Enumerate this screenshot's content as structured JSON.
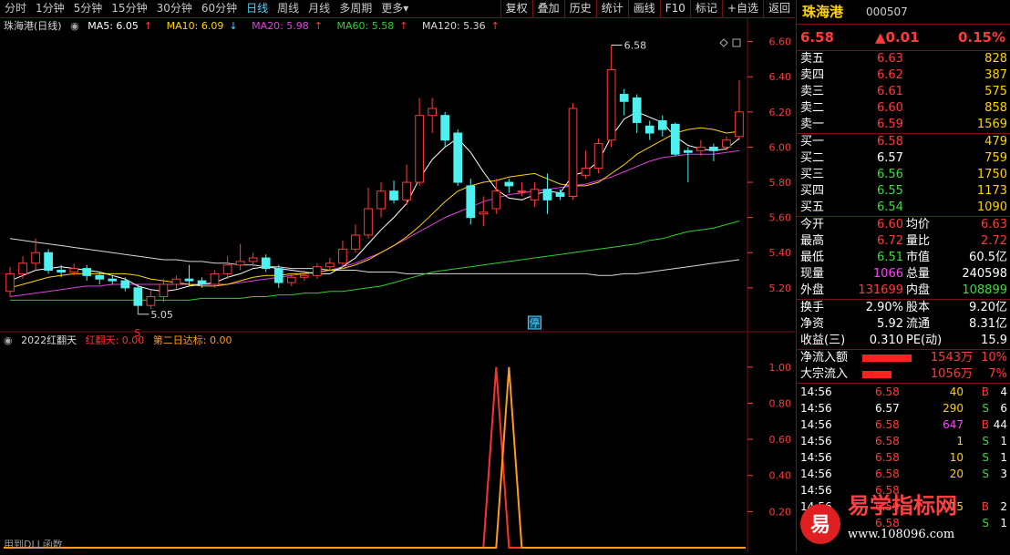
{
  "tabs": [
    "分时",
    "1分钟",
    "5分钟",
    "15分钟",
    "30分钟",
    "60分钟",
    "日线",
    "周线",
    "月线",
    "多周期",
    "更多"
  ],
  "active_tab": "日线",
  "more_arrow": "▾",
  "toolbar": [
    "复权",
    "叠加",
    "历史",
    "统计",
    "画线",
    "F10",
    "标记",
    "+自选",
    "返回"
  ],
  "legend": {
    "title": "珠海港(日线)",
    "ma5": "MA5: 6.05",
    "ma5_arrow": "↑",
    "ma10": "MA10: 6.09",
    "ma10_arrow": "↓",
    "ma20": "MA20: 5.98",
    "ma20_arrow": "↑",
    "ma60": "MA60: 5.58",
    "ma60_arrow": "↑",
    "ma120": "MA120: 5.36",
    "ma120_arrow": "↑"
  },
  "indicator_legend": {
    "name": "2022红翻天",
    "s1": "红翻天: 0.00",
    "s2": "第二日达标: 0.00"
  },
  "bottom_note": "用到DLL函数",
  "markers": {
    "low_label": "5.05",
    "high_label": "6.58",
    "stop_badge": "停",
    "signal": "S"
  },
  "colors": {
    "up": "#ff3a3a",
    "down": "#4ff0f0",
    "ma5": "#ffffff",
    "ma10": "#ffd200",
    "ma20": "#e040e0",
    "ma60": "#30d030",
    "ma120": "#d8d8d8",
    "ind1": "#ff3030",
    "ind2": "#ff9a20",
    "grid": "#7a1010"
  },
  "chart_data": [
    {
      "type": "candlestick",
      "title": "珠海港(日线)",
      "ylim": [
        5.08,
        6.65
      ],
      "yticks": [
        "6.60",
        "6.40",
        "6.20",
        "6.00",
        "5.80",
        "5.60",
        "5.40",
        "5.20"
      ],
      "candles": [
        [
          5.18,
          5.28,
          5.32,
          5.15
        ],
        [
          5.28,
          5.34,
          5.38,
          5.25
        ],
        [
          5.34,
          5.4,
          5.48,
          5.3
        ],
        [
          5.4,
          5.3,
          5.42,
          5.28
        ],
        [
          5.3,
          5.29,
          5.33,
          5.26
        ],
        [
          5.29,
          5.31,
          5.34,
          5.27
        ],
        [
          5.31,
          5.27,
          5.33,
          5.24
        ],
        [
          5.27,
          5.25,
          5.29,
          5.22
        ],
        [
          5.25,
          5.24,
          5.27,
          5.22
        ],
        [
          5.24,
          5.2,
          5.26,
          5.18
        ],
        [
          5.2,
          5.1,
          5.22,
          5.05
        ],
        [
          5.1,
          5.15,
          5.19,
          5.08
        ],
        [
          5.15,
          5.22,
          5.25,
          5.12
        ],
        [
          5.22,
          5.25,
          5.27,
          5.19
        ],
        [
          5.25,
          5.24,
          5.33,
          5.21
        ],
        [
          5.24,
          5.22,
          5.26,
          5.2
        ],
        [
          5.22,
          5.28,
          5.3,
          5.2
        ],
        [
          5.28,
          5.33,
          5.38,
          5.25
        ],
        [
          5.33,
          5.35,
          5.45,
          5.3
        ],
        [
          5.35,
          5.37,
          5.4,
          5.32
        ],
        [
          5.37,
          5.31,
          5.39,
          5.29
        ],
        [
          5.31,
          5.23,
          5.33,
          5.2
        ],
        [
          5.23,
          5.26,
          5.28,
          5.21
        ],
        [
          5.26,
          5.27,
          5.3,
          5.24
        ],
        [
          5.27,
          5.32,
          5.34,
          5.25
        ],
        [
          5.32,
          5.34,
          5.37,
          5.3
        ],
        [
          5.34,
          5.42,
          5.47,
          5.32
        ],
        [
          5.42,
          5.5,
          5.56,
          5.4
        ],
        [
          5.5,
          5.65,
          5.77,
          5.48
        ],
        [
          5.65,
          5.75,
          5.8,
          5.6
        ],
        [
          5.75,
          5.7,
          5.81,
          5.68
        ],
        [
          5.7,
          5.8,
          5.9,
          5.67
        ],
        [
          5.8,
          6.18,
          6.28,
          5.78
        ],
        [
          6.18,
          6.22,
          6.28,
          6.08
        ],
        [
          6.18,
          6.04,
          6.2,
          6.0
        ],
        [
          6.08,
          5.8,
          6.1,
          5.78
        ],
        [
          5.78,
          5.6,
          5.82,
          5.56
        ],
        [
          5.62,
          5.63,
          5.72,
          5.55
        ],
        [
          5.65,
          5.75,
          5.82,
          5.62
        ],
        [
          5.8,
          5.78,
          5.82,
          5.74
        ],
        [
          5.75,
          5.75,
          5.8,
          5.72
        ],
        [
          5.7,
          5.76,
          5.8,
          5.66
        ],
        [
          5.76,
          5.7,
          5.85,
          5.62
        ],
        [
          5.74,
          5.72,
          5.76,
          5.7
        ],
        [
          5.72,
          6.22,
          6.25,
          5.7
        ],
        [
          5.84,
          5.88,
          5.98,
          5.82
        ],
        [
          5.88,
          6.02,
          6.05,
          5.85
        ],
        [
          6.04,
          6.44,
          6.58,
          6.0
        ],
        [
          6.3,
          6.26,
          6.33,
          6.18
        ],
        [
          6.28,
          6.14,
          6.3,
          6.08
        ],
        [
          6.12,
          6.08,
          6.15,
          6.04
        ],
        [
          6.15,
          6.1,
          6.18,
          6.06
        ],
        [
          6.13,
          5.96,
          6.14,
          5.95
        ],
        [
          5.98,
          5.97,
          6.0,
          5.8
        ],
        [
          5.98,
          6.0,
          6.04,
          5.95
        ],
        [
          6.0,
          5.98,
          6.02,
          5.92
        ],
        [
          6.0,
          6.04,
          6.06,
          5.98
        ],
        [
          6.06,
          6.2,
          6.38,
          6.04
        ]
      ],
      "ma5": [
        5.24,
        5.27,
        5.3,
        5.31,
        5.32,
        5.31,
        5.3,
        5.29,
        5.27,
        5.25,
        5.21,
        5.19,
        5.18,
        5.19,
        5.21,
        5.22,
        5.23,
        5.26,
        5.28,
        5.31,
        5.32,
        5.31,
        5.3,
        5.29,
        5.28,
        5.28,
        5.32,
        5.37,
        5.45,
        5.53,
        5.6,
        5.68,
        5.82,
        5.93,
        6.0,
        6.05,
        5.97,
        5.86,
        5.76,
        5.71,
        5.7,
        5.73,
        5.75,
        5.74,
        5.84,
        5.86,
        5.92,
        6.06,
        6.16,
        6.2,
        6.17,
        6.14,
        6.06,
        6.01,
        5.99,
        5.98,
        5.99,
        6.05
      ],
      "ma10": [
        5.2,
        5.22,
        5.24,
        5.26,
        5.27,
        5.28,
        5.28,
        5.28,
        5.28,
        5.28,
        5.27,
        5.25,
        5.24,
        5.23,
        5.22,
        5.21,
        5.21,
        5.22,
        5.24,
        5.26,
        5.27,
        5.27,
        5.28,
        5.28,
        5.29,
        5.3,
        5.31,
        5.33,
        5.36,
        5.4,
        5.44,
        5.49,
        5.55,
        5.62,
        5.69,
        5.75,
        5.78,
        5.8,
        5.81,
        5.83,
        5.84,
        5.85,
        5.82,
        5.79,
        5.78,
        5.78,
        5.8,
        5.85,
        5.9,
        5.96,
        6.0,
        6.04,
        6.08,
        6.1,
        6.11,
        6.1,
        6.08,
        6.09
      ],
      "ma20": [
        5.15,
        5.16,
        5.17,
        5.18,
        5.19,
        5.2,
        5.21,
        5.21,
        5.22,
        5.22,
        5.22,
        5.22,
        5.22,
        5.22,
        5.22,
        5.22,
        5.22,
        5.22,
        5.23,
        5.24,
        5.25,
        5.26,
        5.27,
        5.28,
        5.29,
        5.3,
        5.32,
        5.34,
        5.37,
        5.4,
        5.44,
        5.48,
        5.52,
        5.56,
        5.6,
        5.63,
        5.66,
        5.69,
        5.71,
        5.73,
        5.74,
        5.75,
        5.76,
        5.77,
        5.78,
        5.79,
        5.81,
        5.83,
        5.86,
        5.89,
        5.92,
        5.94,
        5.95,
        5.96,
        5.96,
        5.96,
        5.97,
        5.98
      ],
      "ma60": [
        5.13,
        5.13,
        5.13,
        5.13,
        5.13,
        5.13,
        5.13,
        5.13,
        5.13,
        5.13,
        5.13,
        5.13,
        5.13,
        5.13,
        5.13,
        5.14,
        5.14,
        5.14,
        5.14,
        5.15,
        5.15,
        5.16,
        5.16,
        5.17,
        5.17,
        5.18,
        5.18,
        5.19,
        5.2,
        5.21,
        5.23,
        5.25,
        5.27,
        5.29,
        5.3,
        5.31,
        5.32,
        5.33,
        5.34,
        5.35,
        5.36,
        5.37,
        5.38,
        5.39,
        5.4,
        5.41,
        5.42,
        5.43,
        5.44,
        5.45,
        5.47,
        5.48,
        5.5,
        5.52,
        5.53,
        5.54,
        5.56,
        5.58
      ],
      "ma120": [
        5.48,
        5.47,
        5.46,
        5.45,
        5.44,
        5.43,
        5.42,
        5.41,
        5.4,
        5.39,
        5.38,
        5.37,
        5.36,
        5.36,
        5.35,
        5.35,
        5.34,
        5.34,
        5.33,
        5.33,
        5.32,
        5.32,
        5.31,
        5.31,
        5.31,
        5.3,
        5.3,
        5.3,
        5.29,
        5.29,
        5.29,
        5.28,
        5.28,
        5.28,
        5.28,
        5.28,
        5.28,
        5.28,
        5.28,
        5.28,
        5.28,
        5.28,
        5.28,
        5.28,
        5.28,
        5.28,
        5.27,
        5.27,
        5.28,
        5.28,
        5.29,
        5.3,
        5.31,
        5.32,
        5.33,
        5.34,
        5.35,
        5.36
      ]
    },
    {
      "type": "line",
      "title": "2022红翻天",
      "ylim": [
        0,
        1.1
      ],
      "yticks": [
        "1.00",
        "0.80",
        "0.60",
        "0.40",
        "0.20"
      ],
      "series": [
        {
          "name": "红翻天",
          "peak_index": 38,
          "peak_value": 1.0
        },
        {
          "name": "第二日达标",
          "peak_index": 39,
          "peak_value": 1.0
        }
      ]
    }
  ],
  "panel": {
    "name": "珠海港",
    "code": "000507",
    "price": "6.58",
    "change": "▲0.01",
    "change_pct": "0.15%",
    "asks": [
      {
        "label": "卖五",
        "price": "6.63",
        "vol": "828"
      },
      {
        "label": "卖四",
        "price": "6.62",
        "vol": "387"
      },
      {
        "label": "卖三",
        "price": "6.61",
        "vol": "575"
      },
      {
        "label": "卖二",
        "price": "6.60",
        "vol": "858"
      },
      {
        "label": "卖一",
        "price": "6.59",
        "vol": "1569"
      }
    ],
    "bids": [
      {
        "label": "买一",
        "price": "6.58",
        "vol": "479"
      },
      {
        "label": "买二",
        "price": "6.57",
        "vol": "759"
      },
      {
        "label": "买三",
        "price": "6.56",
        "vol": "1750"
      },
      {
        "label": "买四",
        "price": "6.55",
        "vol": "1173"
      },
      {
        "label": "买五",
        "price": "6.54",
        "vol": "1090"
      }
    ],
    "stats": [
      {
        "l1": "今开",
        "v1": "6.60",
        "l2": "均价",
        "v2": "6.63"
      },
      {
        "l1": "最高",
        "v1": "6.72",
        "l2": "量比",
        "v2": "2.72"
      },
      {
        "l1": "最低",
        "v1": "6.51",
        "l2": "市值",
        "v2": "60.5亿"
      },
      {
        "l1": "现量",
        "v1": "1066",
        "l2": "总量",
        "v2": "240598"
      },
      {
        "l1": "外盘",
        "v1": "131699",
        "l2": "内盘",
        "v2": "108899"
      }
    ],
    "fund": [
      {
        "l1": "换手",
        "v1": "2.90%",
        "l2": "股本",
        "v2": "9.20亿"
      },
      {
        "l1": "净资",
        "v1": "5.92",
        "l2": "流通",
        "v2": "8.31亿"
      },
      {
        "l1": "收益(三)",
        "v1": "0.310",
        "l2": "PE(动)",
        "v2": "15.9"
      }
    ],
    "flow": [
      {
        "label": "净流入额",
        "value": "1543万",
        "pct": "10%"
      },
      {
        "label": "大宗流入",
        "value": "1056万",
        "pct": "7%"
      }
    ],
    "trades": [
      {
        "time": "14:56",
        "price": "6.58",
        "vol": "40",
        "side": "B",
        "n": "4"
      },
      {
        "time": "14:56",
        "price": "6.57",
        "vol": "290",
        "side": "S",
        "n": "6"
      },
      {
        "time": "14:56",
        "price": "6.58",
        "vol": "647",
        "side": "B",
        "n": "44"
      },
      {
        "time": "14:56",
        "price": "6.58",
        "vol": "1",
        "side": "S",
        "n": "1"
      },
      {
        "time": "14:56",
        "price": "6.58",
        "vol": "10",
        "side": "S",
        "n": "1"
      },
      {
        "time": "14:56",
        "price": "6.58",
        "vol": "20",
        "side": "S",
        "n": "3"
      },
      {
        "time": "14:56",
        "price": "6.58",
        "vol": "",
        "side": "",
        "n": ""
      },
      {
        "time": "14:56",
        "price": "6.59",
        "vol": "15",
        "side": "B",
        "n": "2"
      },
      {
        "time": "14:56",
        "price": "6.58",
        "vol": "",
        "side": "S",
        "n": "1"
      }
    ]
  },
  "watermark": {
    "logo_char": "易",
    "title": "易学指标网",
    "url": "www.108096.com"
  }
}
